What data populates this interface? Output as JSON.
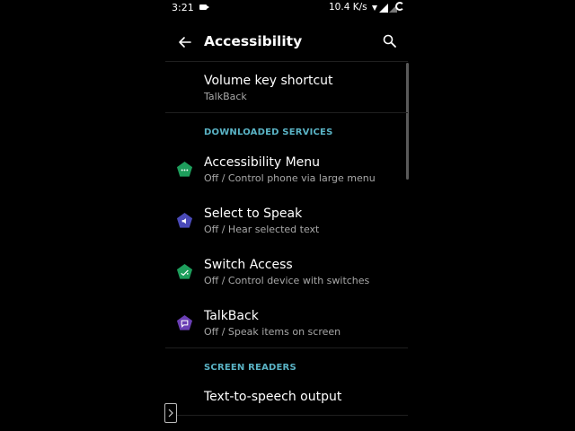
{
  "status": {
    "time": "3:21",
    "speed": "10.4 K/s"
  },
  "appbar": {
    "title": "Accessibility"
  },
  "items": {
    "volume": {
      "title": "Volume key shortcut",
      "subtitle": "TalkBack"
    },
    "section_downloaded": "DOWNLOADED SERVICES",
    "menu": {
      "title": "Accessibility Menu",
      "subtitle": "Off / Control phone via large menu",
      "icon_color": "#1e9e5c"
    },
    "speak": {
      "title": "Select to Speak",
      "subtitle": "Off / Hear selected text",
      "icon_color": "#4a4ab8"
    },
    "switch": {
      "title": "Switch Access",
      "subtitle": "Off / Control device with switches",
      "icon_color": "#1e9e5c"
    },
    "talkback": {
      "title": "TalkBack",
      "subtitle": "Off / Speak items on screen",
      "icon_color": "#6a3fb5"
    },
    "section_readers": "SCREEN READERS",
    "tts": {
      "title": "Text-to-speech output"
    }
  },
  "colors": {
    "accent": "#5ab3c5",
    "background": "#000000"
  }
}
